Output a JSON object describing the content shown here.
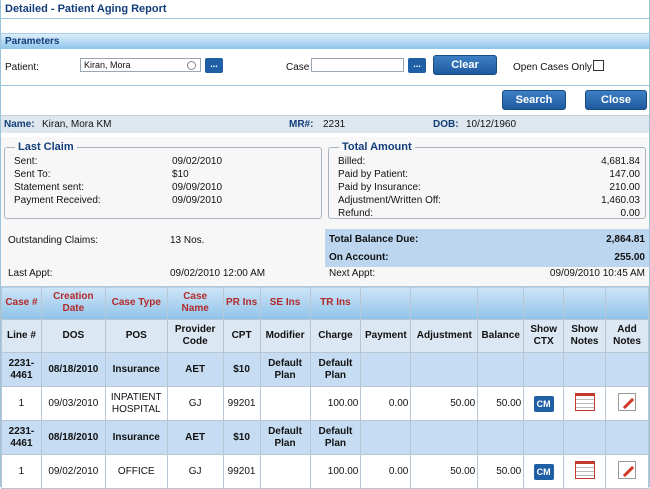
{
  "title": "Detailed - Patient Aging Report",
  "parameters": {
    "header": "Parameters",
    "patient_label": "Patient:",
    "patient_value": "Kiran, Mora",
    "case_label": "Case",
    "case_value": "",
    "lookup_label": "...",
    "clear_label": "Clear",
    "open_cases_label": "Open Cases Only",
    "open_cases_checked": false
  },
  "actions": {
    "search_label": "Search",
    "close_label": "Close"
  },
  "patient_info": {
    "name_label": "Name:",
    "name_value": "Kiran, Mora KM",
    "mr_label": "MR#:",
    "mr_value": "2231",
    "dob_label": "DOB:",
    "dob_value": "10/12/1960"
  },
  "last_claim": {
    "title": "Last Claim",
    "rows": [
      {
        "k": "Sent:",
        "v": "09/02/2010"
      },
      {
        "k": "Sent To:",
        "v": "$10"
      },
      {
        "k": "Statement sent:",
        "v": "09/09/2010"
      },
      {
        "k": "Payment Received:",
        "v": "09/09/2010"
      }
    ]
  },
  "total_amount": {
    "title": "Total Amount",
    "rows": [
      {
        "k": "Billed:",
        "v": "4,681.84"
      },
      {
        "k": "Paid by Patient:",
        "v": "147.00"
      },
      {
        "k": "Paid by Insurance:",
        "v": "210.00"
      },
      {
        "k": "Adjustment/Written Off:",
        "v": "1,460.03"
      },
      {
        "k": "Refund:",
        "v": "0.00"
      }
    ]
  },
  "summary": {
    "outstanding_label": "Outstanding Claims:",
    "outstanding_value": "13 Nos.",
    "last_appt_label": "Last Appt:",
    "last_appt_value": "09/02/2010 12:00 AM",
    "total_due_label": "Total Balance Due:",
    "total_due_value": "2,864.81",
    "on_account_label": "On Account:",
    "on_account_value": "255.00",
    "next_appt_label": "Next Appt:",
    "next_appt_value": "09/09/2010 10:45 AM"
  },
  "table": {
    "case_headers": [
      "Case #",
      "Creation Date",
      "Case Type",
      "Case Name",
      "PR Ins",
      "SE Ins",
      "TR Ins",
      "",
      "",
      "",
      "",
      "",
      "",
      ""
    ],
    "line_headers": [
      "Line #",
      "DOS",
      "POS",
      "Provider Code",
      "CPT",
      "Modifier",
      "Charge",
      "Payment",
      "Adjustment",
      "Balance",
      "Show CTX",
      "Show Notes",
      "Add Notes"
    ],
    "groups": [
      {
        "case": [
          "2231-4461",
          "08/18/2010",
          "Insurance",
          "AET",
          "$10",
          "Default Plan",
          "Default Plan"
        ],
        "line": {
          "line": "1",
          "dos": "09/03/2010",
          "pos": "INPATIENT HOSPITAL",
          "provider": "GJ",
          "cpt": "99201",
          "modifier": "",
          "charge": "100.00",
          "payment": "0.00",
          "adjustment": "50.00",
          "balance": "50.00",
          "ctx": "CM"
        }
      },
      {
        "case": [
          "2231-4461",
          "08/18/2010",
          "Insurance",
          "AET",
          "$10",
          "Default Plan",
          "Default Plan"
        ],
        "line": {
          "line": "1",
          "dos": "09/02/2010",
          "pos": "OFFICE",
          "provider": "GJ",
          "cpt": "99201",
          "modifier": "",
          "charge": "100.00",
          "payment": "0.00",
          "adjustment": "50.00",
          "balance": "50.00",
          "ctx": "CM"
        }
      }
    ]
  }
}
